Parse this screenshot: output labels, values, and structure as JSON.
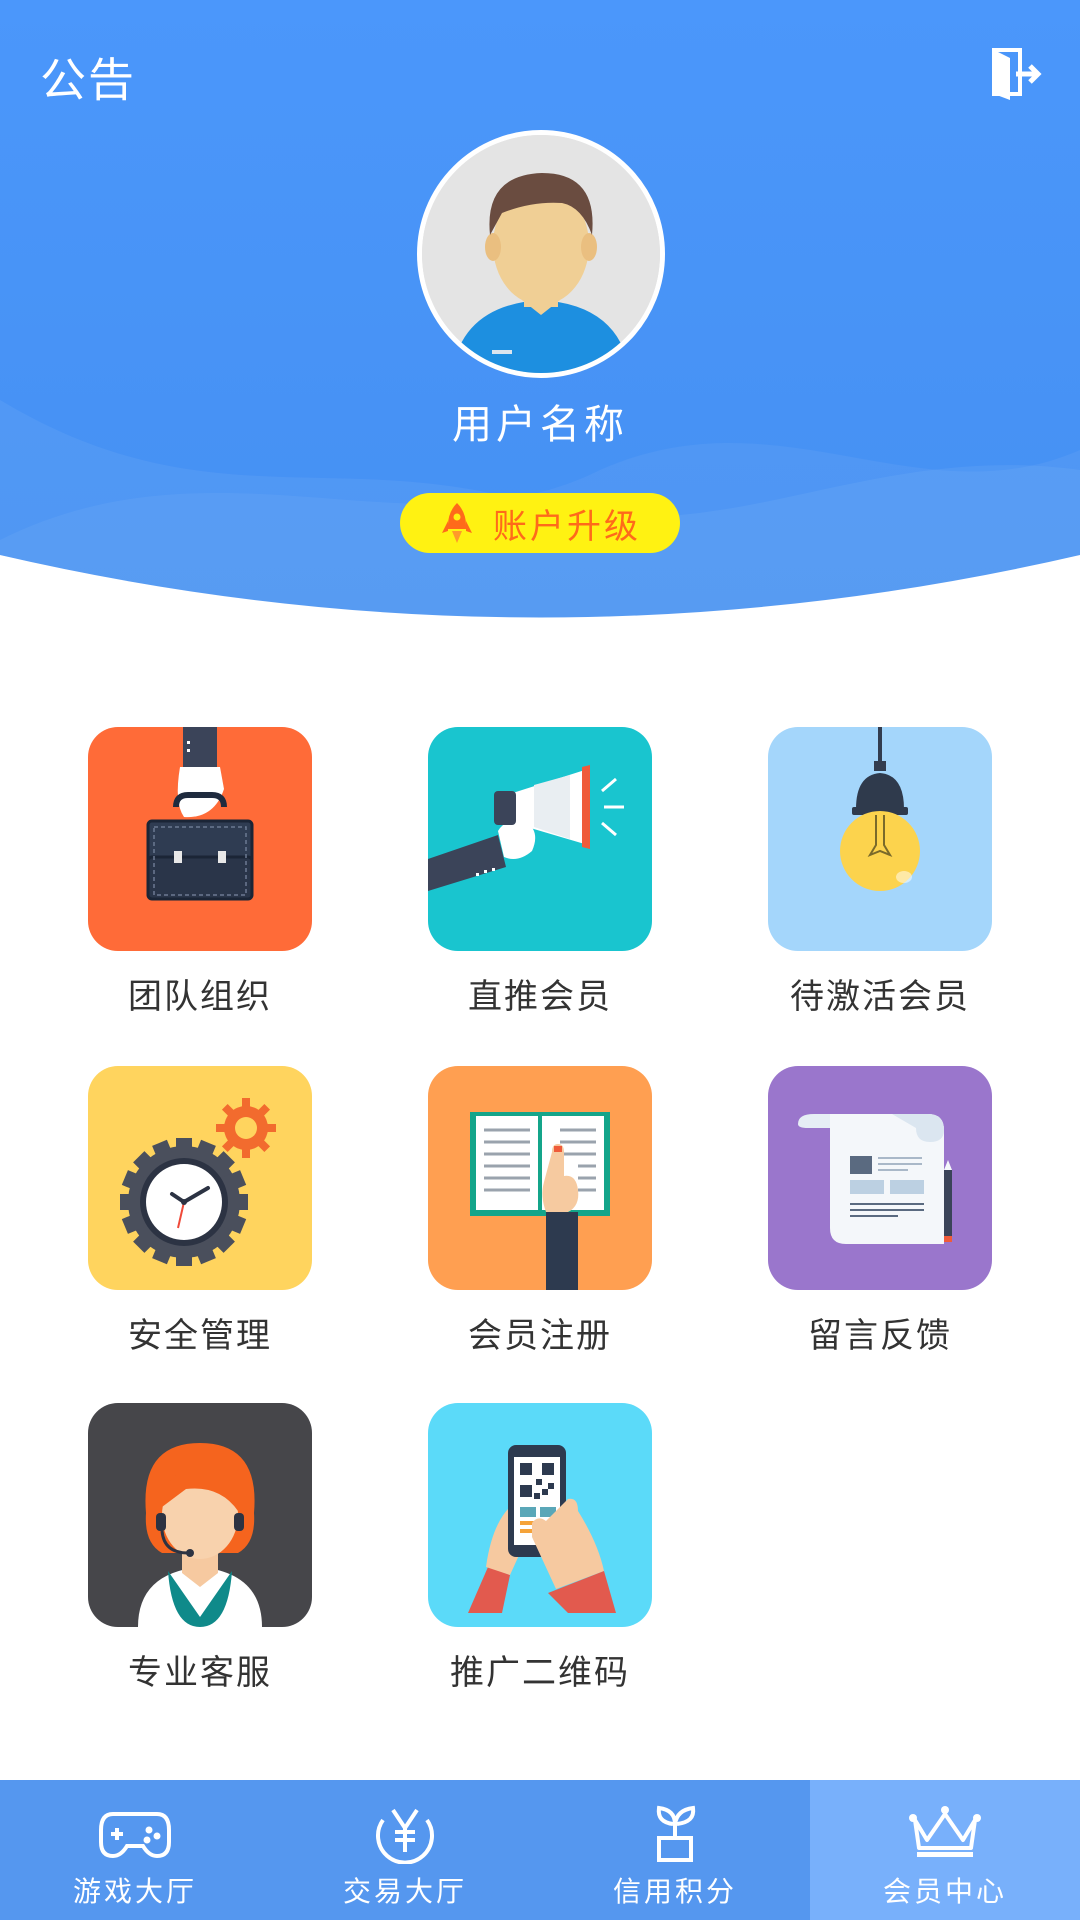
{
  "header": {
    "notice_label": "公告",
    "username": "用户名称",
    "upgrade_label": "账户升级",
    "colors": {
      "primary": "#4a94f6",
      "upgrade_bg": "#fff212",
      "upgrade_text": "#ff6a1a"
    }
  },
  "grid": [
    {
      "label": "团队组织",
      "icon": "briefcase-icon",
      "color": "#ff6b38"
    },
    {
      "label": "直推会员",
      "icon": "megaphone-icon",
      "color": "#19c5cf"
    },
    {
      "label": "待激活会员",
      "icon": "lightbulb-icon",
      "color": "#a4d6fb"
    },
    {
      "label": "安全管理",
      "icon": "clock-gear-icon",
      "color": "#ffd45e"
    },
    {
      "label": "会员注册",
      "icon": "book-icon",
      "color": "#ff9f51"
    },
    {
      "label": "留言反馈",
      "icon": "document-icon",
      "color": "#9a76cc"
    },
    {
      "label": "专业客服",
      "icon": "support-agent-icon",
      "color": "#46464a"
    },
    {
      "label": "推广二维码",
      "icon": "qr-phone-icon",
      "color": "#5bdaf9"
    }
  ],
  "tabbar": {
    "items": [
      {
        "label": "游戏大厅",
        "icon": "gamepad-icon"
      },
      {
        "label": "交易大厅",
        "icon": "yen-icon"
      },
      {
        "label": "信用积分",
        "icon": "sprout-icon"
      },
      {
        "label": "会员中心",
        "icon": "crown-icon"
      }
    ],
    "active_index": 3
  }
}
